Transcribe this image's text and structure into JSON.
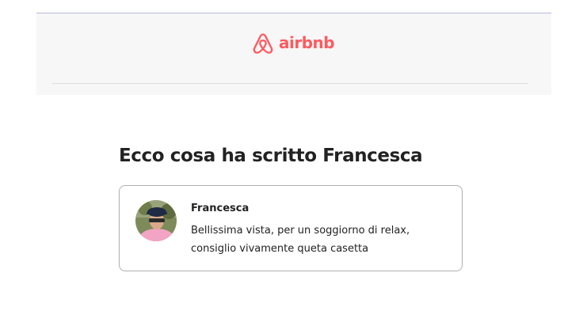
{
  "header": {
    "brand_name": "airbnb",
    "brand_color": "#ff5a5f",
    "logo_icon": "airbnb-belo-icon"
  },
  "main": {
    "heading": "Ecco cosa ha scritto Francesca"
  },
  "review": {
    "reviewer_name": "Francesca",
    "text": "Bellissima vista, per un soggiorno di relax, consiglio vivamente queta casetta",
    "avatar": "reviewer-photo"
  }
}
